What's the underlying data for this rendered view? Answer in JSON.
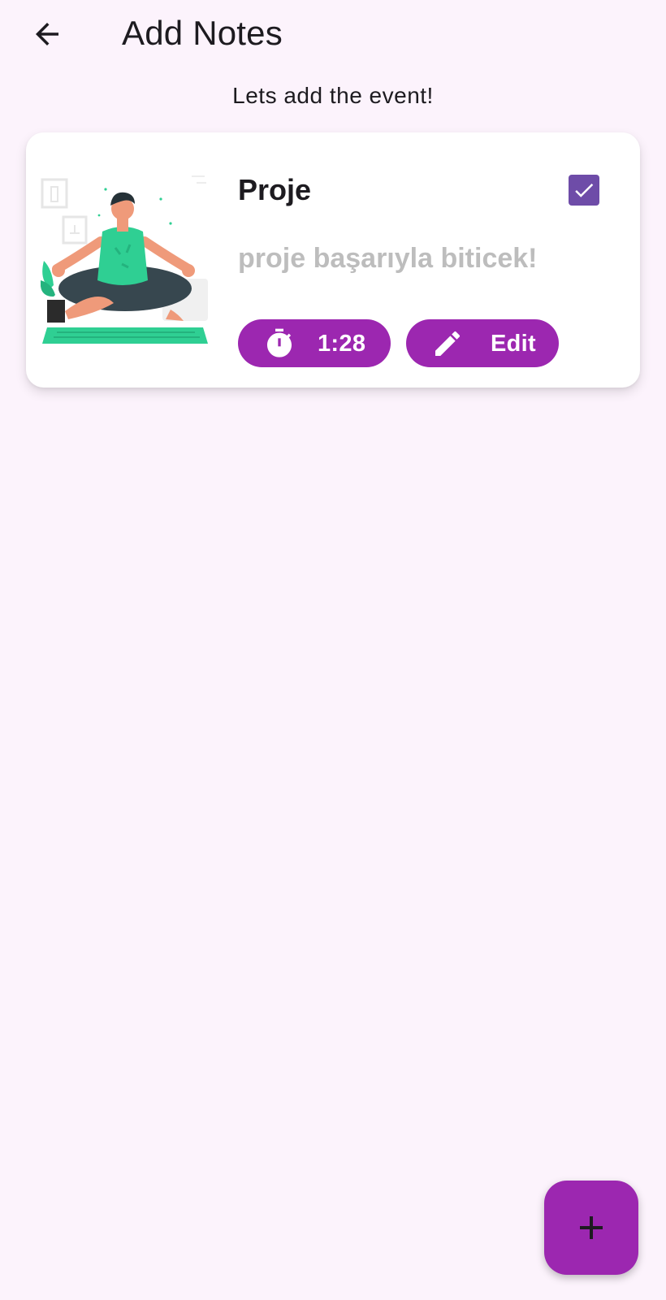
{
  "app_bar": {
    "title": "Add Notes",
    "back_icon": "arrow-left-icon"
  },
  "subtitle": "Lets add the event!",
  "notes": [
    {
      "title": "Proje",
      "body": "proje başarıyla biticek!",
      "completed": true,
      "timer_label": "1:28",
      "timer_icon": "stopwatch-icon",
      "edit_label": "Edit",
      "edit_icon": "pencil-icon",
      "illustration": "meditation-illustration"
    }
  ],
  "fab": {
    "icon": "plus-icon"
  },
  "colors": {
    "background": "#FCF3FC",
    "accent": "#9C27B0",
    "checkbox": "#6E4CA8",
    "muted_text": "#BDBDBD",
    "text": "#1D1B20"
  }
}
